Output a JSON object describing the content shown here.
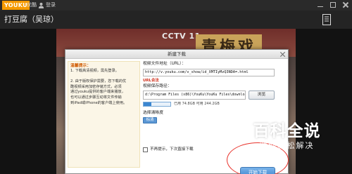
{
  "app": {
    "logo_text": "YOUKU",
    "logo_cn": "优酷",
    "user_label": "登录"
  },
  "player": {
    "video_title": "打豆腐（吴琼）"
  },
  "video_scene": {
    "channel_text": "CCTV 11",
    "plaque_text": "青梅戏"
  },
  "dialog": {
    "title": "新建下载",
    "tips": {
      "title": "温馨提示：",
      "lines": [
        "1. 下载高清视频，需先登录。",
        "",
        "2. 由于版权保护需要，您下载的优",
        "酷视频采用加密存储方式，必须",
        "通过youku提供的客户端来播放，",
        "也可以通过步骤互动将文件传输",
        "到iPad或iPhone的客户端上使用。"
      ]
    },
    "url_label": "视频文件地址（URL）：",
    "url_value": "http://v.youku.com/v_show/id_XMTIyMzQ3NDA=.html",
    "url_status": "URL合法",
    "path_label": "视频保存路径：",
    "path_value": "d:\\Program Files (x86)\\YouKu\\YouKu Files\\download",
    "browse_label": "浏览",
    "disk_used_fraction": 0.3,
    "disk_text": "已用 74.8GB 可用 244.2GB",
    "quality_label": "选择清晰度",
    "quality_option": "标清",
    "remember_label": "不再提示，下次直接下载",
    "start_label": "开始下载"
  },
  "watermark": {
    "main": "百科全说",
    "sub": "助你轻松解决"
  },
  "colors": {
    "logo_orange": "#f59a00",
    "button_blue": "#3d83cc",
    "ring_red": "#e8322b",
    "url_ok_red": "#d0301c"
  }
}
